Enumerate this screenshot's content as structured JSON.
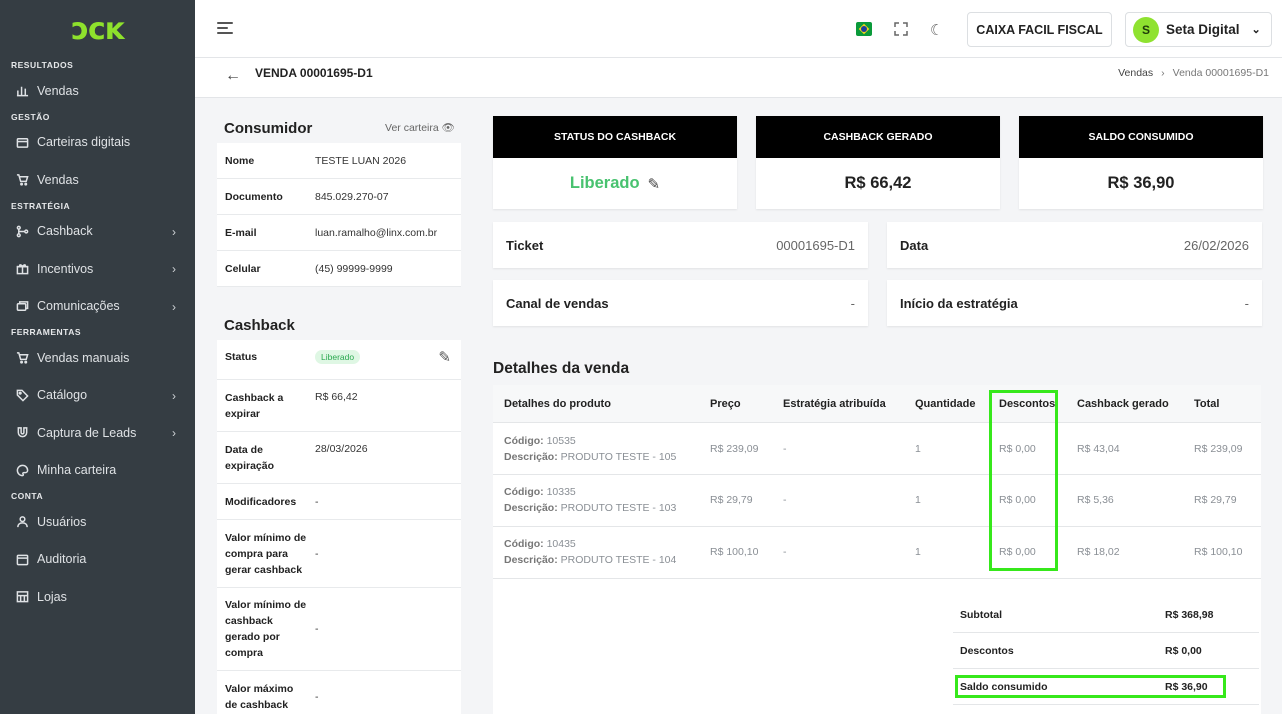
{
  "sidebar": {
    "logo": "ɔcĸ",
    "sections": {
      "resultados": "RESULTADOS",
      "gestao": "GESTÃO",
      "estrategia": "ESTRATÉGIA",
      "ferramentas": "FERRAMENTAS",
      "conta": "CONTA"
    },
    "items": {
      "vendas_resultados": "Vendas",
      "carteiras": "Carteiras digitais",
      "vendas_gestao": "Vendas",
      "cashback": "Cashback",
      "incentivos": "Incentivos",
      "comunicacoes": "Comunicações",
      "vendas_manuais": "Vendas manuais",
      "catalogo": "Catálogo",
      "captura": "Captura de Leads",
      "minha_carteira": "Minha carteira",
      "usuarios": "Usuários",
      "auditoria": "Auditoria",
      "lojas": "Lojas"
    }
  },
  "topbar": {
    "caixa_label": "CAIXA FACIL FISCAL",
    "user_initial": "S",
    "user_name": "Seta Digital"
  },
  "page": {
    "title": "VENDA 00001695-D1",
    "breadcrumb_root": "Vendas",
    "breadcrumb_current": "Venda 00001695-D1"
  },
  "consumer": {
    "title": "Consumidor",
    "ver_carteira": "Ver carteira",
    "rows": [
      {
        "k": "Nome",
        "v": "TESTE LUAN 2026"
      },
      {
        "k": "Documento",
        "v": "845.029.270-07"
      },
      {
        "k": "E-mail",
        "v": "luan.ramalho@linx.com.br"
      },
      {
        "k": "Celular",
        "v": "(45) 99999-9999"
      }
    ]
  },
  "cashback_card": {
    "title": "Cashback",
    "status_label": "Status",
    "status_value": "Liberado",
    "rows": [
      {
        "k": "Cashback a expirar",
        "v": "R$ 66,42"
      },
      {
        "k": "Data de expiração",
        "v": "28/03/2026"
      },
      {
        "k": "Modificadores",
        "v": "-"
      },
      {
        "k": "Valor mínimo de compra para gerar cashback",
        "v": "-"
      },
      {
        "k": "Valor mínimo de cashback gerado por compra",
        "v": "-"
      },
      {
        "k": "Valor máximo de cashback",
        "v": "-"
      }
    ]
  },
  "kpis": {
    "status_title": "STATUS DO CASHBACK",
    "status_value": "Liberado",
    "gerado_title": "CASHBACK GERADO",
    "gerado_value": "R$ 66,42",
    "saldo_title": "SALDO CONSUMIDO",
    "saldo_value": "R$ 36,90"
  },
  "info": {
    "ticket_k": "Ticket",
    "ticket_v": "00001695-D1",
    "data_k": "Data",
    "data_v": "26/02/2026",
    "canal_k": "Canal de vendas",
    "canal_v": "-",
    "inicio_k": "Início da estratégia",
    "inicio_v": "-"
  },
  "details": {
    "title": "Detalhes da venda",
    "columns": [
      "Detalhes do produto",
      "Preço",
      "Estratégia atribuída",
      "Quantidade",
      "Descontos",
      "Cashback gerado",
      "Total"
    ],
    "code_label": "Código:",
    "desc_label": "Descrição:",
    "rows": [
      {
        "code": "10535",
        "desc": "PRODUTO TESTE - 105",
        "preco": "R$ 239,09",
        "estrategia": "-",
        "qtd": "1",
        "desconto": "R$ 0,00",
        "cashback": "R$ 43,04",
        "total": "R$ 239,09"
      },
      {
        "code": "10335",
        "desc": "PRODUTO TESTE - 103",
        "preco": "R$ 29,79",
        "estrategia": "-",
        "qtd": "1",
        "desconto": "R$ 0,00",
        "cashback": "R$ 5,36",
        "total": "R$ 29,79"
      },
      {
        "code": "10435",
        "desc": "PRODUTO TESTE - 104",
        "preco": "R$ 100,10",
        "estrategia": "-",
        "qtd": "1",
        "desconto": "R$ 0,00",
        "cashback": "R$ 18,02",
        "total": "R$ 100,10"
      }
    ],
    "summary": [
      {
        "k": "Subtotal",
        "v": "R$ 368,98"
      },
      {
        "k": "Descontos",
        "v": "R$ 0,00"
      },
      {
        "k": "Saldo consumido",
        "v": "R$ 36,90"
      }
    ]
  },
  "colors": {
    "sidebar_bg": "#353d43",
    "accent_green": "#8ee12c",
    "status_green": "#48c26f",
    "highlight": "#36e81b"
  }
}
